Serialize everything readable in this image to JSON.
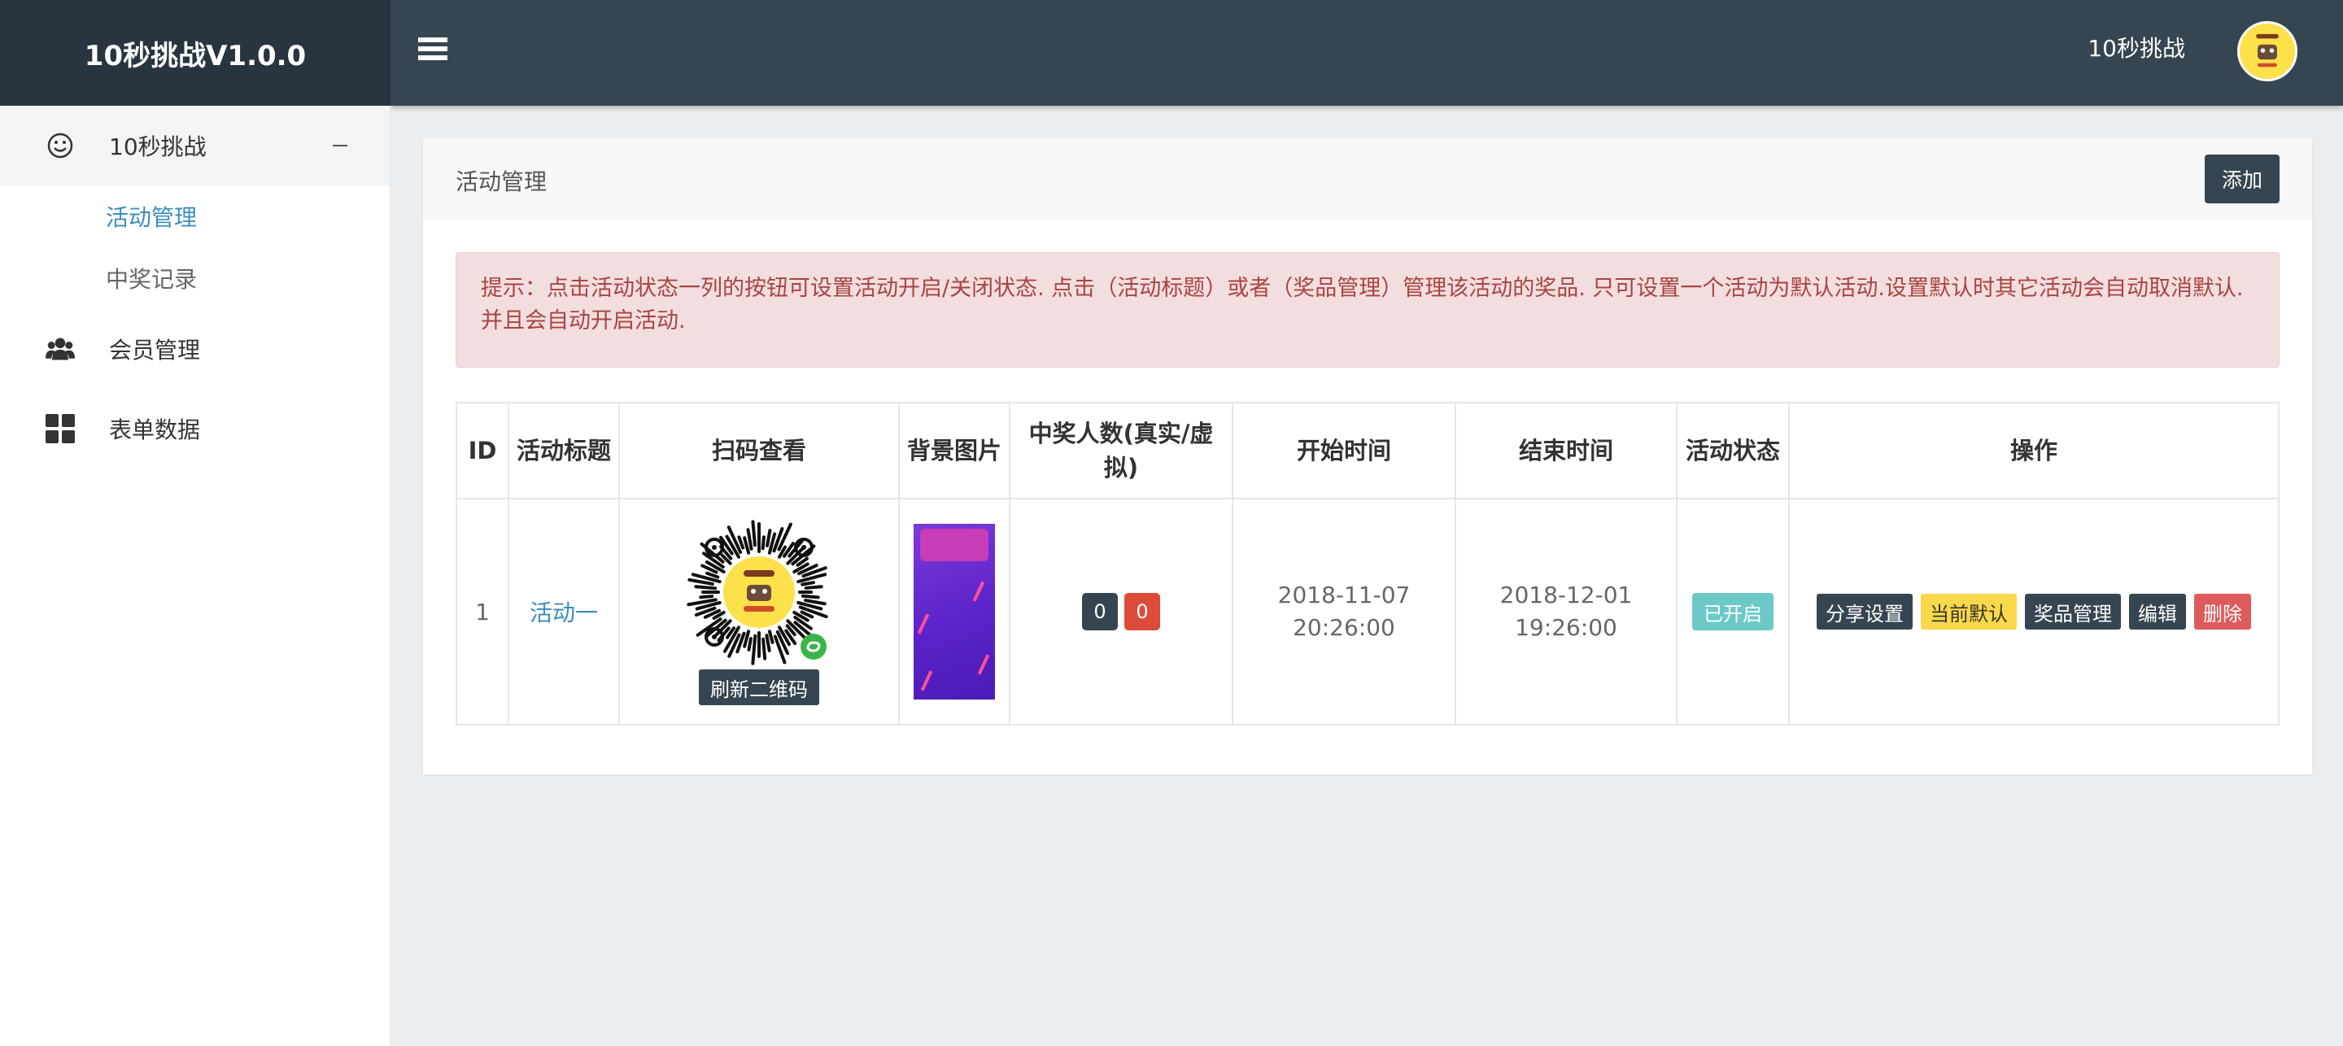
{
  "app": {
    "brand": "10秒挑战V1.0.0"
  },
  "header": {
    "user_name": "10秒挑战"
  },
  "sidebar": {
    "group": {
      "label": "10秒挑战",
      "icon": "smile-icon"
    },
    "sub_items": [
      {
        "label": "活动管理",
        "active": true
      },
      {
        "label": "中奖记录",
        "active": false
      }
    ],
    "items": [
      {
        "label": "会员管理",
        "icon": "users-icon"
      },
      {
        "label": "表单数据",
        "icon": "grid-icon"
      }
    ]
  },
  "panel": {
    "title": "活动管理",
    "add_button": "添加",
    "alert": "提示：点击活动状态一列的按钮可设置活动开启/关闭状态. 点击（活动标题）或者（奖品管理）管理该活动的奖品. 只可设置一个活动为默认活动.设置默认时其它活动会自动取消默认.并且会自动开启活动."
  },
  "table": {
    "headers": [
      "ID",
      "活动标题",
      "扫码查看",
      "背景图片",
      "中奖人数(真实/虚拟)",
      "开始时间",
      "结束时间",
      "活动状态",
      "操作"
    ],
    "rows": [
      {
        "id": "1",
        "title": "活动一",
        "refresh_qr": "刷新二维码",
        "winners_real": "0",
        "winners_virtual": "0",
        "start_date": "2018-11-07",
        "start_time": "20:26:00",
        "end_date": "2018-12-01",
        "end_time": "19:26:00",
        "status": "已开启",
        "actions": {
          "share": "分享设置",
          "default": "当前默认",
          "prizes": "奖品管理",
          "edit": "编辑",
          "delete": "删除"
        }
      }
    ]
  },
  "colors": {
    "header_dark": "#283540",
    "topbar": "#354551",
    "link": "#3c8dbc",
    "alert_bg": "#f2dede",
    "alert_text": "#a94442",
    "status_on": "#6cc9c7",
    "default_yellow": "#f9d84a",
    "danger": "#dd5b5b"
  }
}
